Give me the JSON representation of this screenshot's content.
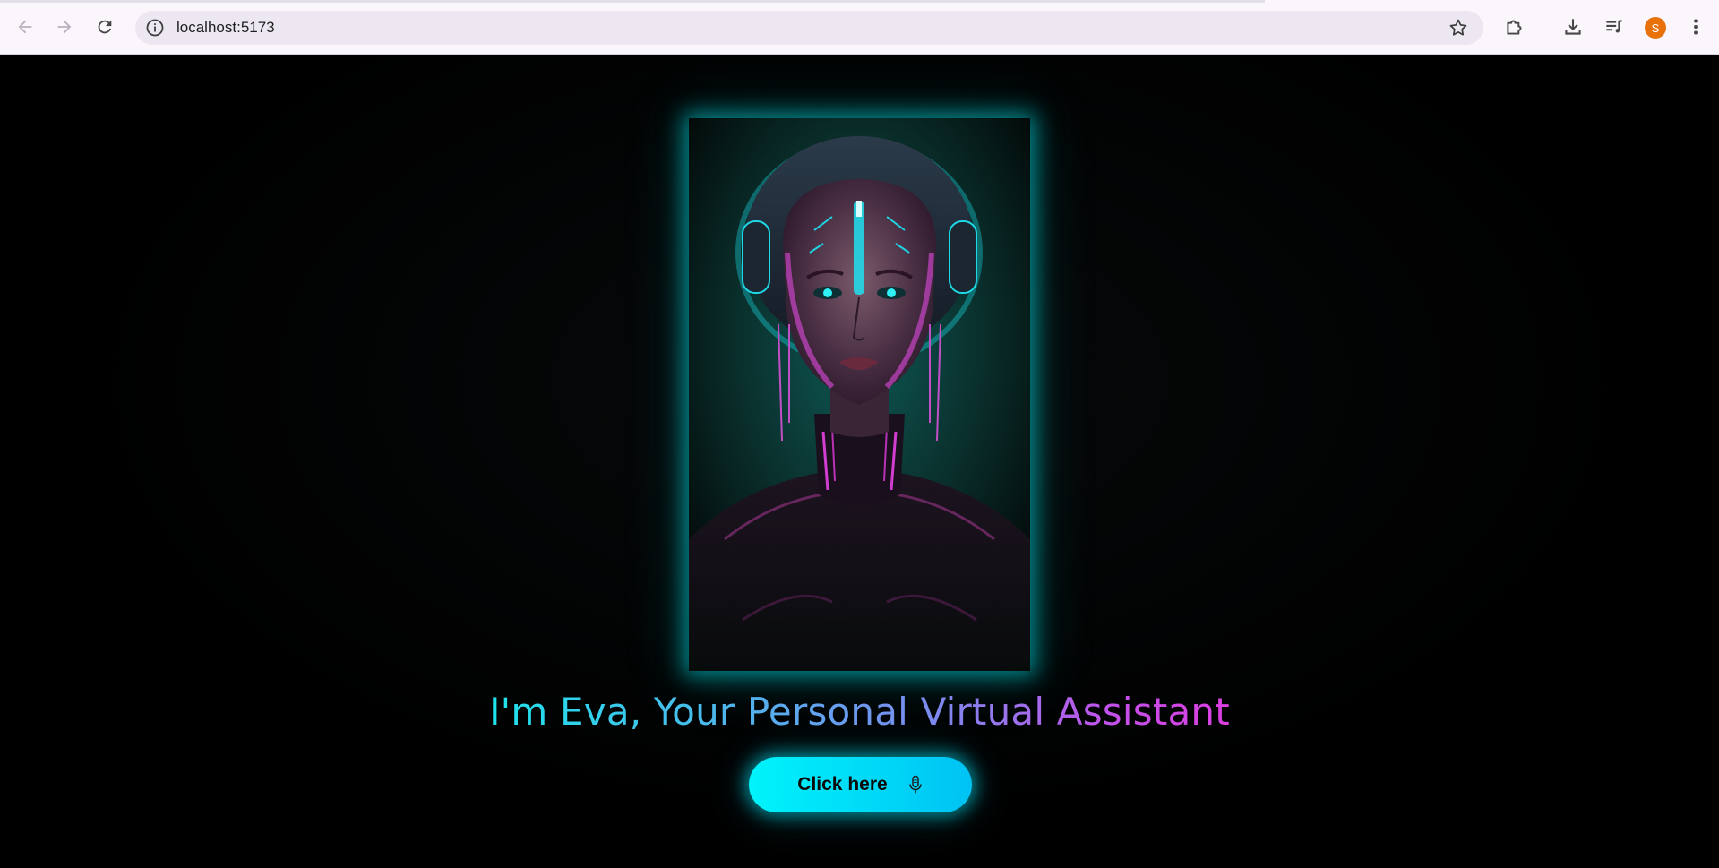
{
  "browser": {
    "url": "localhost:5173",
    "profile_initial": "S",
    "profile_color": "#e8710a",
    "icons": [
      "back-icon",
      "forward-icon",
      "reload-icon",
      "site-info-icon",
      "bookmark-star-icon",
      "extensions-icon",
      "download-icon",
      "media-controls-icon",
      "more-menu-icon"
    ]
  },
  "hero": {
    "image": "cyberpunk-android-portrait",
    "headline": "I'm Eva, Your Personal Virtual Assistant",
    "headline_gradient": [
      "#1fe3ec",
      "#7d8aef",
      "#dc3fe0"
    ],
    "cta_label": "Click here",
    "cta_icon": "microphone-icon",
    "accent_color": "#00e5f5"
  }
}
